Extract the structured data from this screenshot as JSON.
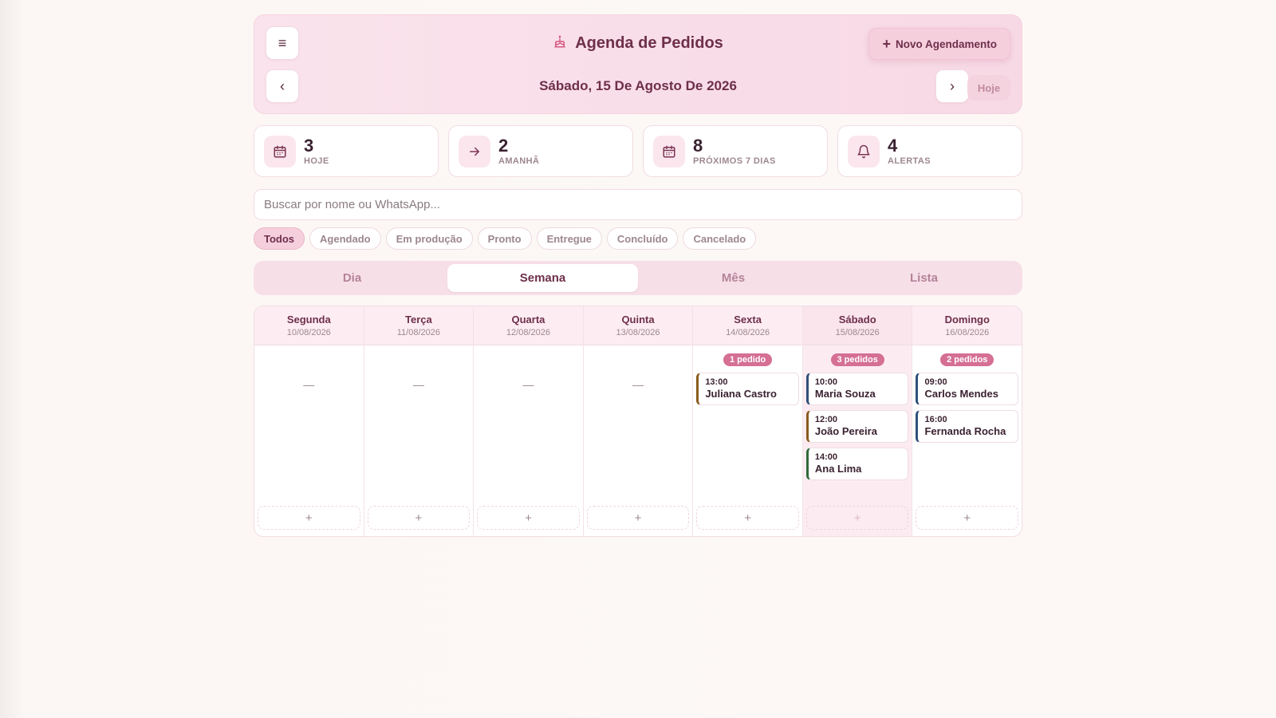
{
  "header": {
    "title": "Agenda de Pedidos",
    "new_button": "Novo Agendamento",
    "date": "Sábado, 15 De Agosto De 2026",
    "today_button": "Hoje",
    "menu_glyph": "≡",
    "prev_glyph": "‹",
    "next_glyph": "›",
    "new_glyph": "+"
  },
  "stats": [
    {
      "value": "3",
      "label": "HOJE",
      "icon": "calendar-icon"
    },
    {
      "value": "2",
      "label": "AMANHÃ",
      "icon": "arrow-right-icon"
    },
    {
      "value": "8",
      "label": "PRÓXIMOS 7 DIAS",
      "icon": "calendar-icon"
    },
    {
      "value": "4",
      "label": "ALERTAS",
      "icon": "bell-icon"
    }
  ],
  "search": {
    "placeholder": "Buscar por nome ou WhatsApp..."
  },
  "filters": [
    "Todos",
    "Agendado",
    "Em produção",
    "Pronto",
    "Entregue",
    "Concluído",
    "Cancelado"
  ],
  "tabs": [
    "Dia",
    "Semana",
    "Mês",
    "Lista"
  ],
  "week": {
    "empty_glyph": "—",
    "add_glyph": "+",
    "days": [
      {
        "name": "Segunda",
        "date": "10/08/2026",
        "badge": "",
        "events": []
      },
      {
        "name": "Terça",
        "date": "11/08/2026",
        "badge": "",
        "events": []
      },
      {
        "name": "Quarta",
        "date": "12/08/2026",
        "badge": "",
        "events": []
      },
      {
        "name": "Quinta",
        "date": "13/08/2026",
        "badge": "",
        "events": []
      },
      {
        "name": "Sexta",
        "date": "14/08/2026",
        "badge": "1 pedido",
        "events": [
          {
            "time": "13:00",
            "name": "Juliana Castro",
            "color": "#8a5a1e"
          }
        ]
      },
      {
        "name": "Sábado",
        "date": "15/08/2026",
        "badge": "3 pedidos",
        "events": [
          {
            "time": "10:00",
            "name": "Maria Souza",
            "color": "#2f4f79"
          },
          {
            "time": "12:00",
            "name": "João Pereira",
            "color": "#8a5a1e"
          },
          {
            "time": "14:00",
            "name": "Ana Lima",
            "color": "#2f6a3a"
          }
        ]
      },
      {
        "name": "Domingo",
        "date": "16/08/2026",
        "badge": "2 pedidos",
        "events": [
          {
            "time": "09:00",
            "name": "Carlos Mendes",
            "color": "#2f4f79"
          },
          {
            "time": "16:00",
            "name": "Fernanda Rocha",
            "color": "#2f4f79"
          }
        ]
      }
    ]
  },
  "colors": {
    "accent": "#d56f93",
    "primary_text": "#6e2f4a"
  }
}
